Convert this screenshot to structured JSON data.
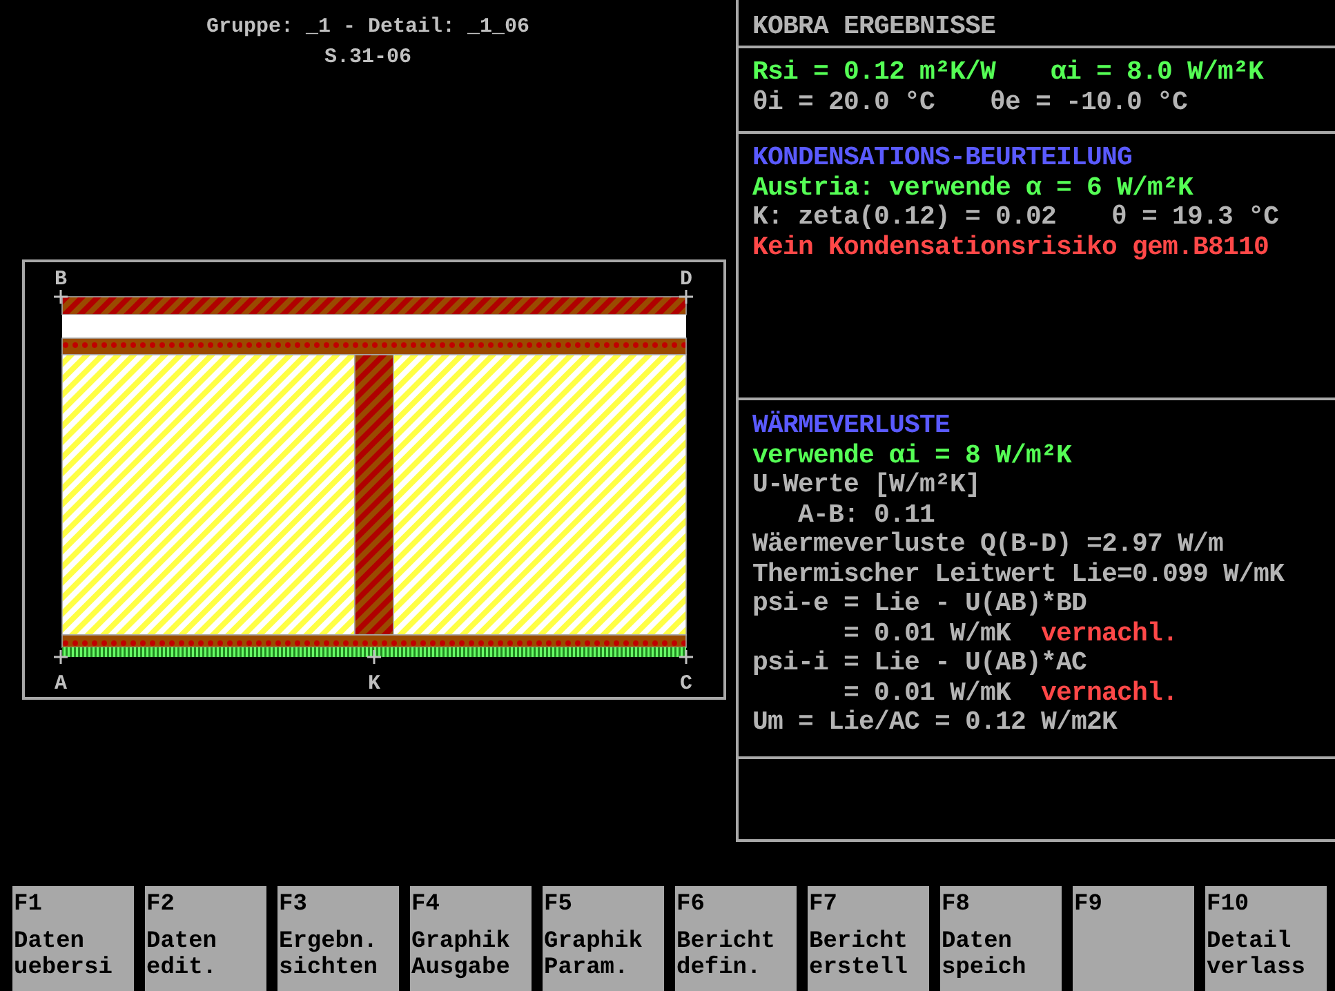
{
  "header": {
    "title": "Gruppe: _1 - Detail: _1_06",
    "code": "S.31-06"
  },
  "diagram": {
    "points": [
      {
        "label": "B"
      },
      {
        "label": "D"
      },
      {
        "label": "A"
      },
      {
        "label": "K"
      },
      {
        "label": "C"
      }
    ]
  },
  "panels": [
    {
      "lines": [
        [
          {
            "text": "KOBRA ERGEBNISSE",
            "kind": "label"
          }
        ]
      ]
    },
    {
      "lines": [
        [
          {
            "text": "Rsi = 0.12 m²K/W",
            "kind": "value"
          },
          {
            "text": "αi = 8.0 W/m²K",
            "kind": "value"
          }
        ],
        [
          {
            "text": "θi = 20.0 °C",
            "kind": "label"
          },
          {
            "text": "θe = -10.0 °C",
            "kind": "label"
          }
        ]
      ]
    },
    {
      "lines": [
        [
          {
            "text": "KONDENSATIONS-BEURTEILUNG",
            "kind": "title"
          }
        ],
        [
          {
            "text": "Austria: verwende α = 6 W/m²K",
            "kind": "value"
          }
        ],
        [
          {
            "text": "K: zeta(0.12) = 0.02",
            "kind": "label"
          },
          {
            "text": "θ = 19.3 °C",
            "kind": "label"
          }
        ],
        [
          {
            "text": "Kein Kondensationsrisiko gem.B8110",
            "kind": "warning"
          }
        ]
      ]
    },
    {
      "lines": [
        [
          {
            "text": "WÄRMEVERLUSTE",
            "kind": "title"
          }
        ],
        [
          {
            "text": "verwende αi = 8 W/m²K",
            "kind": "value"
          }
        ],
        [
          {
            "text": "U-Werte [W/m²K]",
            "kind": "label"
          }
        ],
        [
          {
            "text": "   A-B: 0.11",
            "kind": "label"
          }
        ],
        [
          {
            "text": "Wäermeverluste Q(B-D) =2.97 W/m",
            "kind": "label"
          }
        ],
        [
          {
            "text": "Thermischer Leitwert Lie=0.099 W/mK",
            "kind": "label"
          }
        ],
        [
          {
            "text": "psi-e = Lie - U(AB)*BD",
            "kind": "label"
          }
        ],
        [
          {
            "text": "      = 0.01 W/mK",
            "kind": "label"
          },
          {
            "text": "vernachl.",
            "kind": "warning"
          }
        ],
        [
          {
            "text": "psi-i = Lie - U(AB)*AC",
            "kind": "label"
          }
        ],
        [
          {
            "text": "      = 0.01 W/mK",
            "kind": "label"
          },
          {
            "text": "vernachl.",
            "kind": "warning"
          }
        ],
        [
          {
            "text": "Um = Lie/AC = 0.12 W/m2K",
            "kind": "label"
          }
        ]
      ]
    }
  ],
  "function_keys": [
    {
      "key": "F1",
      "label": [
        "Daten",
        "uebersi"
      ]
    },
    {
      "key": "F2",
      "label": [
        "Daten",
        "edit."
      ]
    },
    {
      "key": "F3",
      "label": [
        "Ergebn.",
        "sichten"
      ]
    },
    {
      "key": "F4",
      "label": [
        "Graphik",
        "Ausgabe"
      ]
    },
    {
      "key": "F5",
      "label": [
        "Graphik",
        "Param."
      ]
    },
    {
      "key": "F6",
      "label": [
        "Bericht",
        "defin."
      ]
    },
    {
      "key": "F7",
      "label": [
        "Bericht",
        "erstell"
      ]
    },
    {
      "key": "F8",
      "label": [
        "Daten",
        "speich"
      ]
    },
    {
      "key": "F9"
    },
    {
      "key": "F10",
      "label": [
        "Detail",
        "verlass"
      ]
    }
  ]
}
